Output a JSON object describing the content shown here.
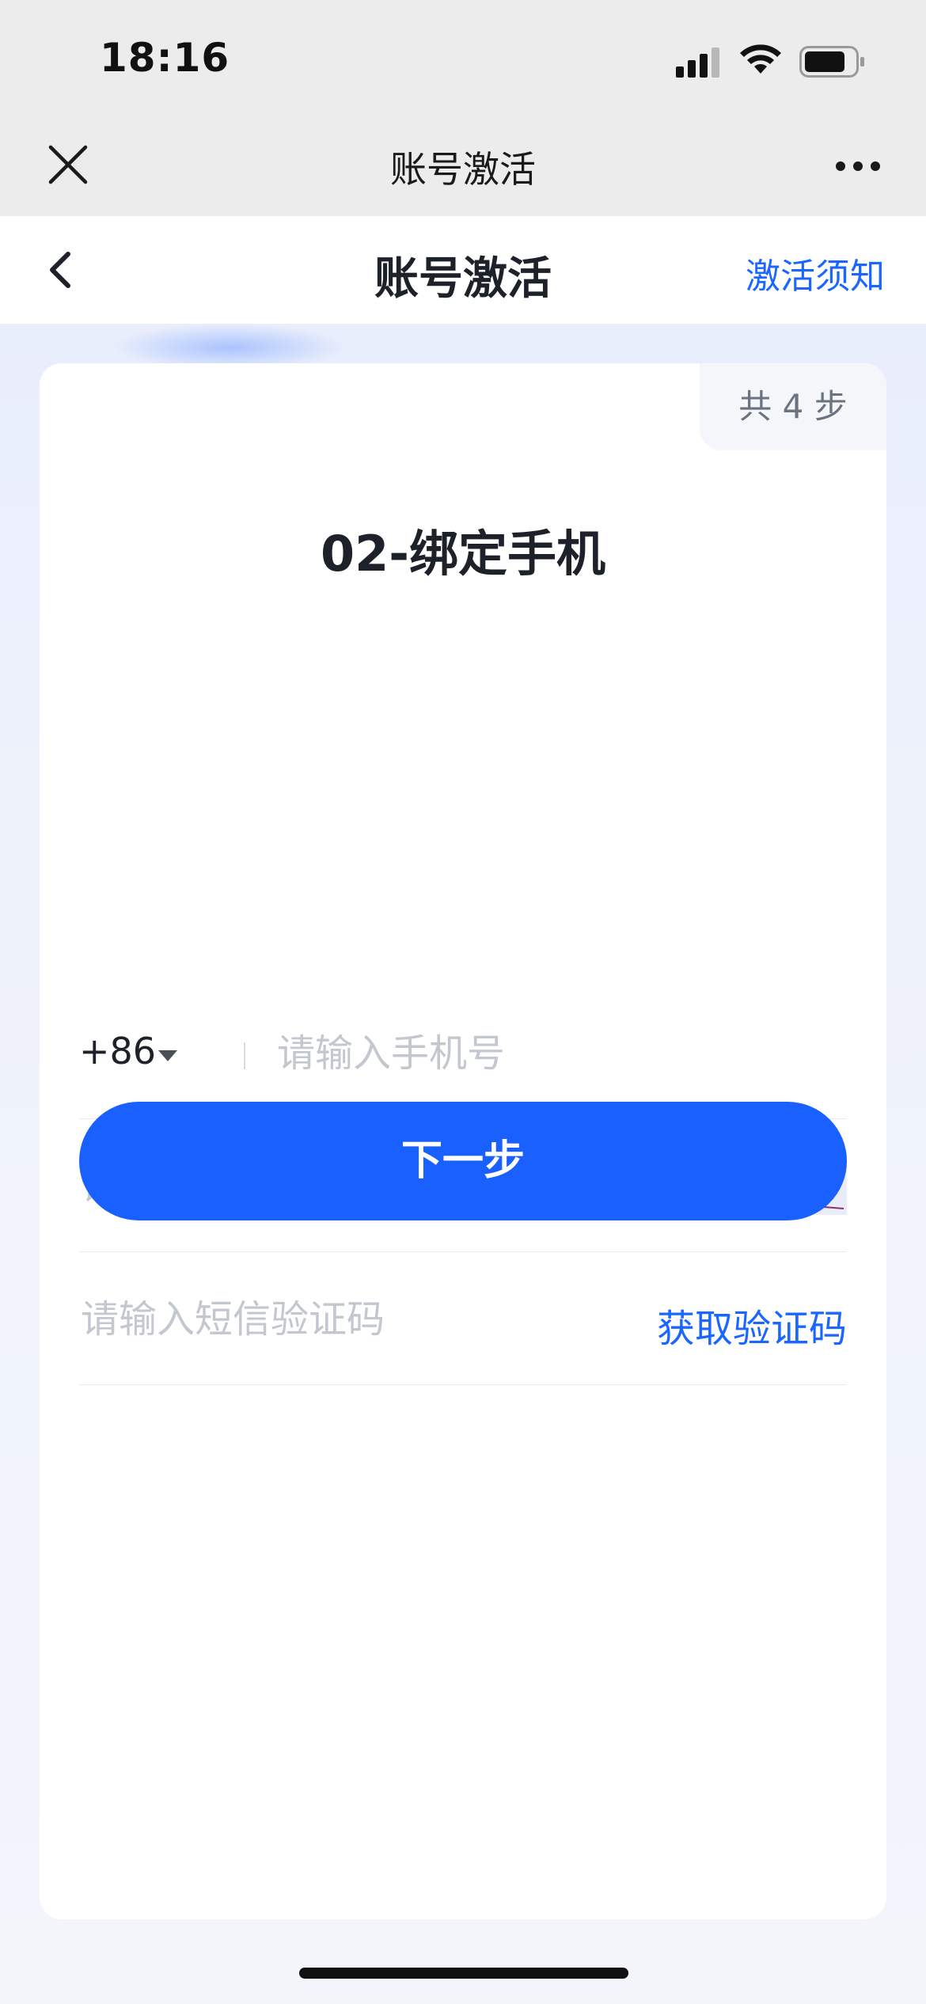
{
  "status_bar": {
    "time": "18:16"
  },
  "mini_header": {
    "title": "账号激活",
    "close_icon": "close-icon",
    "more_icon": "more-icon"
  },
  "nav_bar": {
    "title": "账号激活",
    "right_link": "激活须知",
    "back_icon": "chevron-left-icon"
  },
  "card": {
    "step_badge": "共 4 步",
    "title": "02-绑定手机",
    "phone": {
      "country_code": "+86",
      "placeholder": "请输入手机号",
      "value": ""
    },
    "captcha": {
      "placeholder": "请输入验证码",
      "value": "",
      "image_text": "SLu3"
    },
    "sms": {
      "placeholder": "请输入短信验证码",
      "value": "",
      "link_label": "获取验证码"
    },
    "next_button": "下一步"
  },
  "colors": {
    "accent": "#1a66ff",
    "button": "#1960ff",
    "title": "#1d2129",
    "placeholder": "#c3c7cf"
  }
}
